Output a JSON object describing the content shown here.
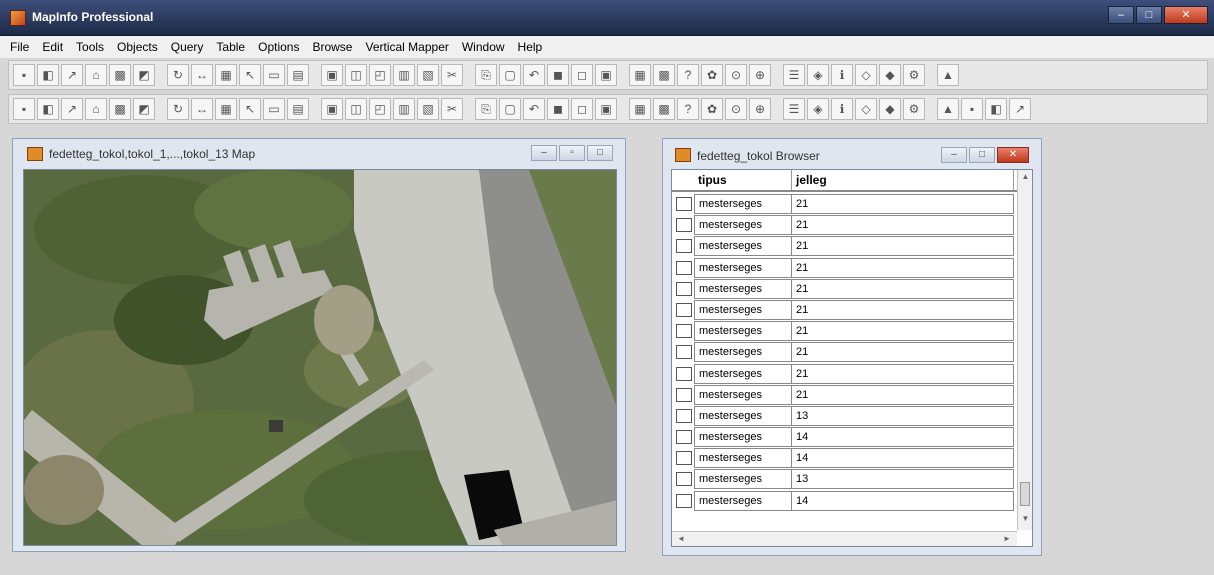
{
  "app": {
    "title": "MapInfo Professional"
  },
  "menu": [
    "File",
    "Edit",
    "Tools",
    "Objects",
    "Query",
    "Table",
    "Options",
    "Browse",
    "Vertical Mapper",
    "Window",
    "Help"
  ],
  "toolbar1": [
    "save-icon",
    "layer-icon",
    "draw-icon",
    "select-icon",
    "image-icon",
    "chart-icon",
    "rotate-icon",
    "move-icon",
    "grid-icon",
    "pointer-icon",
    "new-icon",
    "open-icon",
    "table-icon",
    "window-icon",
    "browser-icon",
    "layout-icon",
    "print-icon",
    "cut-icon",
    "copy-icon",
    "paste-icon",
    "undo-icon",
    "map-icon",
    "map2-icon",
    "map3-icon",
    "map4-icon",
    "map5-icon",
    "help-icon",
    "globe-icon",
    "find-icon",
    "zoom-icon",
    "layers-icon",
    "query-icon",
    "info-icon",
    "legend-icon",
    "style-icon",
    "tools-icon",
    "thematic-icon"
  ],
  "toolbar2": [
    "line-icon",
    "polyline-icon",
    "arc-icon",
    "angle-icon",
    "polygon-icon",
    "ellipse-icon",
    "rectangle-icon",
    "rounded-rect-icon",
    "text-icon",
    "frame-icon",
    "house-icon",
    "arrow-icon",
    "symbol-icon",
    "reshape-icon",
    "node-icon",
    "text-style-icon",
    "select-arrow-icon",
    "radius-icon",
    "boundary-icon",
    "polygon-select-icon",
    "marquee-icon",
    "invert-icon",
    "unselect-icon",
    "graph-icon",
    "zoom-in-icon",
    "zoom-out-icon",
    "change-view-icon",
    "grabber-icon",
    "info-tool-icon",
    "ruler-icon",
    "label-icon",
    "drag-icon",
    "layer-control-icon",
    "legend-tool-icon",
    "statistics-icon",
    "sigma-icon",
    "merge-icon",
    "split-icon",
    "thematic-tool-icon",
    "circle-tool-icon"
  ],
  "mapWindow": {
    "title": "fedetteg_tokol,tokol_1,...,tokol_13 Map"
  },
  "browserWindow": {
    "title": "fedetteg_tokol Browser",
    "columns": [
      "tipus",
      "jelleg"
    ],
    "rows": [
      {
        "tipus": "mesterseges",
        "jelleg": "21"
      },
      {
        "tipus": "mesterseges",
        "jelleg": "21"
      },
      {
        "tipus": "mesterseges",
        "jelleg": "21"
      },
      {
        "tipus": "mesterseges",
        "jelleg": "21"
      },
      {
        "tipus": "mesterseges",
        "jelleg": "21"
      },
      {
        "tipus": "mesterseges",
        "jelleg": "21"
      },
      {
        "tipus": "mesterseges",
        "jelleg": "21"
      },
      {
        "tipus": "mesterseges",
        "jelleg": "21"
      },
      {
        "tipus": "mesterseges",
        "jelleg": "21"
      },
      {
        "tipus": "mesterseges",
        "jelleg": "21"
      },
      {
        "tipus": "mesterseges",
        "jelleg": "13"
      },
      {
        "tipus": "mesterseges",
        "jelleg": "14"
      },
      {
        "tipus": "mesterseges",
        "jelleg": "14"
      },
      {
        "tipus": "mesterseges",
        "jelleg": "13"
      },
      {
        "tipus": "mesterseges",
        "jelleg": "14"
      }
    ]
  },
  "colors": {
    "titlebar": "#1e2a48",
    "windowFrame": "#dfe6ef",
    "closeButton": "#c0391d",
    "appIcon": "#e08a28"
  }
}
